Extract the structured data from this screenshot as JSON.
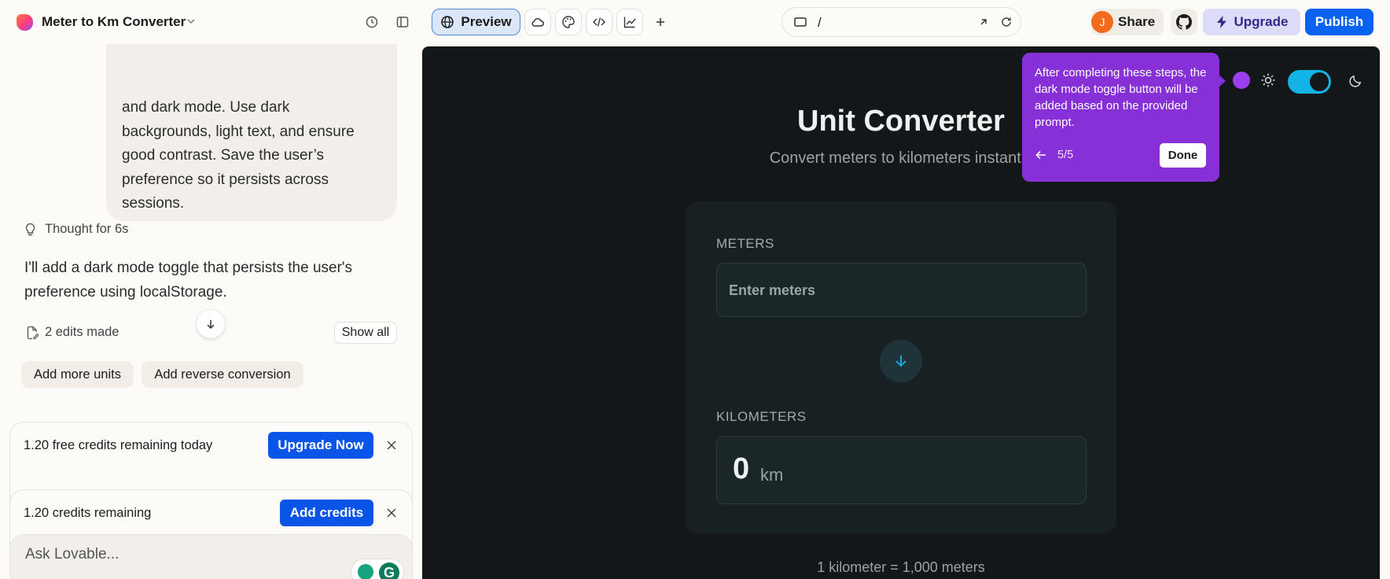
{
  "header": {
    "project_title": "Meter to Km Converter",
    "preview_label": "Preview",
    "url_path": "/",
    "avatar_initial": "J",
    "share_label": "Share",
    "upgrade_label": "Upgrade",
    "publish_label": "Publish"
  },
  "chat": {
    "user_message": "and dark mode. Use dark\nbackgrounds, light text, and ensure\ngood contrast. Save the user’s\npreference so it persists across\nsessions.",
    "thought_label": "Thought for 6s",
    "assistant_reply": "I'll add a dark mode toggle that persists the user's preference using localStorage.",
    "edits_label": "2 edits made",
    "show_all_label": "Show all",
    "suggestions": [
      "Add more units",
      "Add reverse conversion"
    ],
    "credits_banner": {
      "text": "1.20 free credits remaining today",
      "button": "Upgrade Now"
    },
    "credits_banner2": {
      "text": "1.20 credits remaining",
      "button": "Add credits"
    },
    "input_placeholder": "Ask Lovable...",
    "grammarly_letter": "G"
  },
  "preview": {
    "title": "Unit Converter",
    "subtitle": "Convert meters to kilometers instantly",
    "meters_label": "METERS",
    "meters_placeholder": "Enter meters",
    "km_label": "KILOMETERS",
    "km_value": "0",
    "km_unit": "km",
    "footer": "1 kilometer = 1,000 meters",
    "theme_toggle_on": true
  },
  "tour": {
    "text": "After completing these steps, the dark mode toggle button will be added based on the provided prompt.",
    "step": "5/5",
    "done_label": "Done"
  },
  "colors": {
    "accent_blue": "#0a63f0",
    "tour_purple": "#8730d8",
    "toggle_cyan": "#13b3e6",
    "preview_bg": "#131719"
  }
}
